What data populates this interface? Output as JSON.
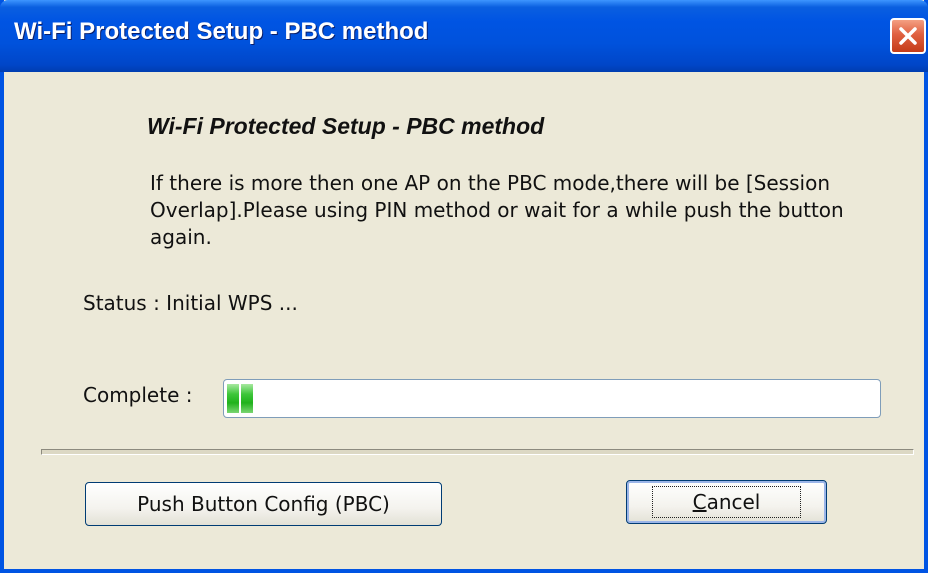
{
  "window": {
    "title": "Wi-Fi Protected Setup - PBC method",
    "close_icon": "close-icon"
  },
  "main": {
    "heading": "Wi-Fi Protected Setup - PBC method",
    "description": "If there is more then one AP on the PBC mode,there will be [Session Overlap].Please using PIN method or wait for a while push the button again.",
    "status_text": "Status : Initial WPS ...",
    "complete_label": "Complete :",
    "progress_fraction": 0.05
  },
  "buttons": {
    "pbc_label": "Push Button Config (PBC)",
    "cancel_label_first": "C",
    "cancel_label_rest": "ancel"
  },
  "colors": {
    "titlebar": "#0054e3",
    "dialog_background": "#ece9d8",
    "progress": "#20b21c",
    "close_button": "#c43c18"
  }
}
